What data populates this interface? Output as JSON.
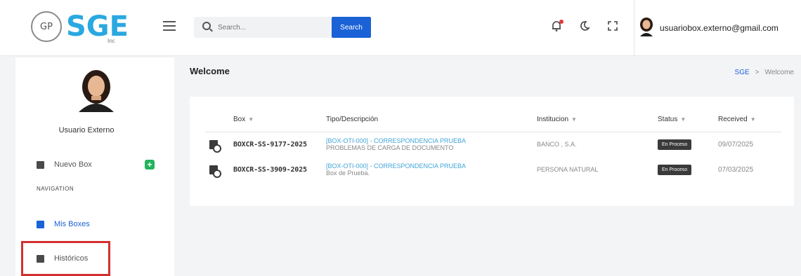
{
  "header": {
    "logo_mark": "GP",
    "logo_text": "SGE",
    "logo_sub": "Inc",
    "search": {
      "placeholder": "Search...",
      "button_label": "Search"
    },
    "icons": [
      "bell-icon",
      "moon-icon",
      "fullscreen-icon"
    ],
    "user_email": "usuariobox.externo@gmail.com"
  },
  "sidebar": {
    "user_name": "Usuario Externo",
    "new_box_label": "Nuevo Box",
    "new_box_plus": "+",
    "nav_heading": "NAVIGATION",
    "items": [
      {
        "label": "Mis Boxes",
        "active": true
      },
      {
        "label": "Históricos",
        "active": false
      }
    ]
  },
  "main": {
    "title": "Welcome",
    "breadcrumb": {
      "root": "SGE",
      "separator": ">",
      "current": "Welcome"
    },
    "table": {
      "columns": [
        "Box",
        "Tipo/Descripción",
        "Institucion",
        "Status",
        "Received"
      ],
      "rows": [
        {
          "box": "BOXCR-SS-9177-2025",
          "tipo": "[BOX-OTI-000] - CORRESPONDENCIA PRUEBA",
          "descripcion": "PROBLEMAS DE CARGA DE DOCUMENTO",
          "institucion": "BANCO                      , S.A.",
          "status": "En Proceso",
          "received": "09/07/2025"
        },
        {
          "box": "BOXCR-SS-3909-2025",
          "tipo": "[BOX-OTI-000] - CORRESPONDENCIA PRUEBA",
          "descripcion": "Box de Prueba.",
          "institucion": "PERSONA NATURAL",
          "status": "En Proceso",
          "received": "07/03/2025"
        }
      ]
    }
  },
  "colors": {
    "brand": "#2aa8e0",
    "primary": "#1a62d6",
    "link": "#41a5d8",
    "status_bg": "#3a3a3a",
    "highlight": "#d32f2f",
    "add_green": "#24b35c"
  }
}
